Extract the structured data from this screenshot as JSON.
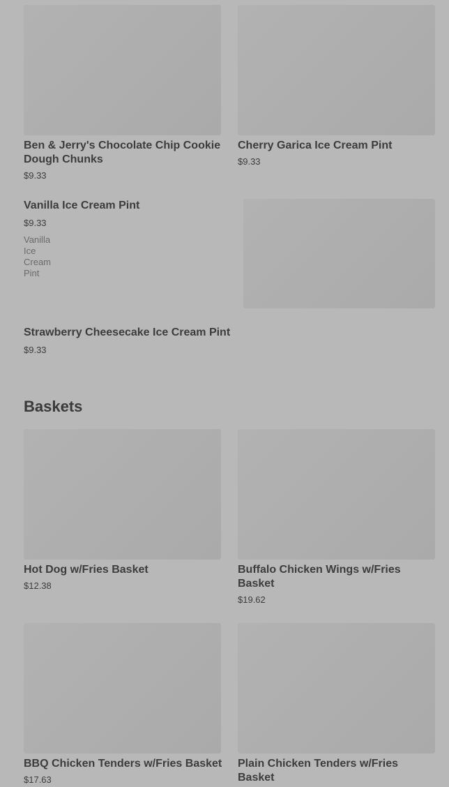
{
  "colors": {
    "overlay": "#b8b8b8",
    "text": "#3c3c3c",
    "muted": "#6a6a6a"
  },
  "ice_cream": {
    "items": [
      {
        "name": "Ben & Jerry's Chocolate Chip Cookie Dough Chunks",
        "price": "$9.33"
      },
      {
        "name": "Cherry Garica Ice Cream Pint",
        "price": "$9.33"
      },
      {
        "name": "Vanilla Ice Cream Pint",
        "price": "$9.33",
        "description": "Vanilla Ice Cream Pint"
      },
      {
        "name": "Strawberry Cheesecake Ice Cream Pint",
        "price": "$9.33"
      }
    ]
  },
  "baskets": {
    "title": "Baskets",
    "items": [
      {
        "name": "Hot Dog w/Fries Basket",
        "price": "$12.38"
      },
      {
        "name": "Buffalo Chicken Wings w/Fries Basket",
        "price": "$19.62"
      },
      {
        "name": "BBQ Chicken Tenders w/Fries Basket",
        "price": "$17.63"
      },
      {
        "name": "Plain Chicken Tenders w/Fries Basket",
        "price": ""
      }
    ]
  }
}
